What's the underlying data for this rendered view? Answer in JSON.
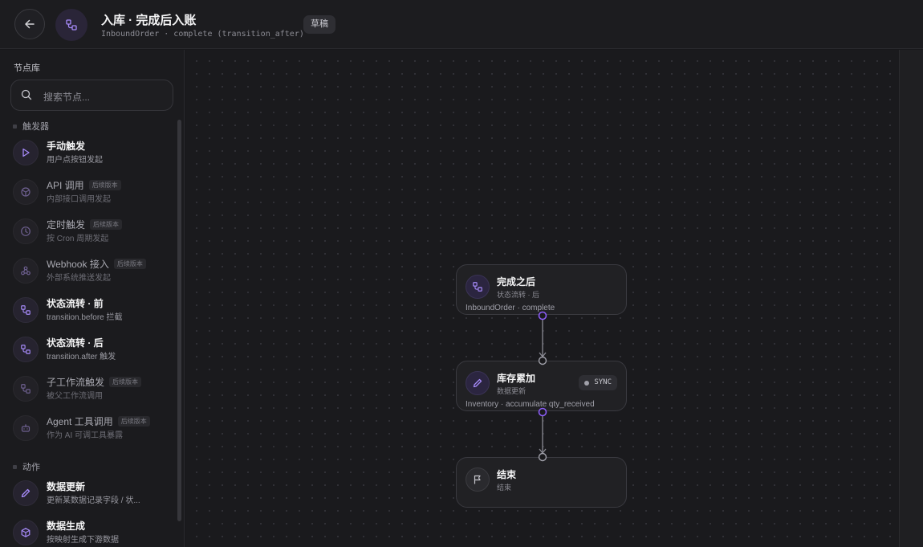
{
  "header": {
    "back_icon": "arrow-left-icon",
    "title_icon": "workflow-icon",
    "title": "入库 · 完成后入账",
    "subtitle": "InboundOrder · complete (transition_after)",
    "status_badge": "草稿"
  },
  "sidebar": {
    "title": "节点库",
    "search_placeholder": "搜索节点...",
    "sections": {
      "triggers": "触发器",
      "actions": "动作"
    },
    "later_tag": "后续版本",
    "items": [
      {
        "name": "手动触发",
        "desc": "用户点按钮发起",
        "icon": "play-icon"
      },
      {
        "name": "API 调用",
        "desc": "内部接口调用发起",
        "icon": "cube-icon"
      },
      {
        "name": "定时触发",
        "desc": "按 Cron 周期发起",
        "icon": "clock-icon"
      },
      {
        "name": "Webhook 接入",
        "desc": "外部系统推送发起",
        "icon": "webhook-icon"
      },
      {
        "name": "状态流转 · 前",
        "desc": "transition.before 拦截",
        "icon": "transition-icon"
      },
      {
        "name": "状态流转 · 后",
        "desc": "transition.after 触发",
        "icon": "transition-icon"
      },
      {
        "name": "子工作流触发",
        "desc": "被父工作流调用",
        "icon": "subflow-icon"
      },
      {
        "name": "Agent 工具调用",
        "desc": "作为 AI 可调工具暴露",
        "icon": "robot-icon"
      },
      {
        "name": "数据更新",
        "desc": "更新某数据记录字段 / 状...",
        "icon": "pencil-icon"
      },
      {
        "name": "数据生成",
        "desc": "按映射生成下游数据",
        "icon": "box-icon"
      }
    ]
  },
  "canvas": {
    "nodes": [
      {
        "title": "完成之后",
        "sub": "状态流转 · 后",
        "foot": "InboundOrder · complete",
        "icon": "transition-icon"
      },
      {
        "title": "库存累加",
        "sub": "数据更新",
        "foot": "Inventory · accumulate qty_received",
        "badge": "SYNC",
        "icon": "pencil-icon"
      },
      {
        "title": "结束",
        "sub": "结束",
        "icon": "flag-icon"
      }
    ]
  },
  "colors": {
    "accent": "#8b5cf6",
    "background": "#18181b"
  }
}
